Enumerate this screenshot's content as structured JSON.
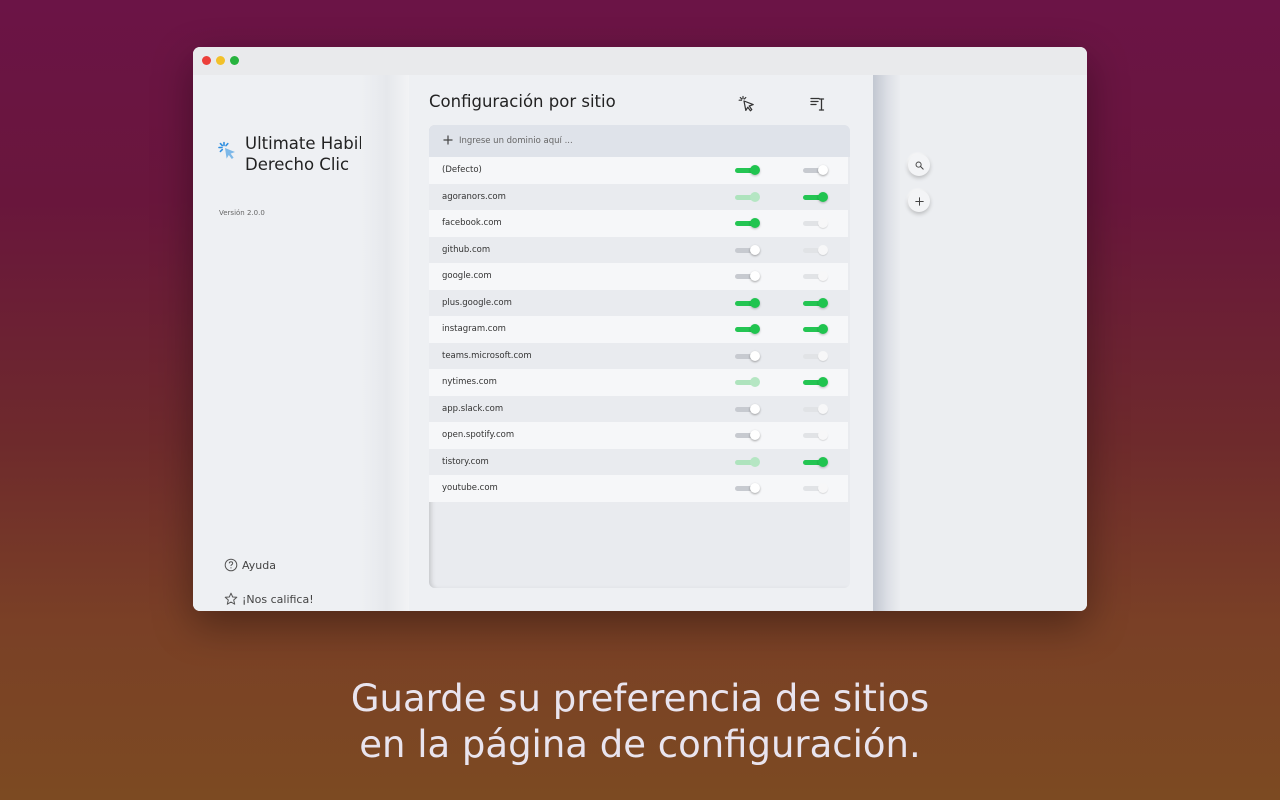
{
  "window": {
    "controls": {
      "red": "#ec3f3a",
      "yellow": "#f2c12a",
      "green": "#27b33e"
    }
  },
  "sidebar": {
    "app_title_line1": "Ultimate Habilitar",
    "app_title_line2": "Derecho Clic",
    "version": "Versión 2.0.0",
    "help_label": "Ayuda",
    "rate_label": "¡Nos califica!",
    "icons": {
      "logo": "cursor-sparkle-icon",
      "help": "question-circle-icon",
      "rate": "star-outline-icon"
    }
  },
  "main": {
    "title": "Configuración por sitio",
    "column_icons": [
      "cursor-click-icon",
      "text-select-icon"
    ],
    "add_placeholder": "Ingrese un dominio aquí ...",
    "accent_color": "#24c553",
    "rows": [
      {
        "domain": "(Defecto)",
        "right_click": "on",
        "text_select": "off"
      },
      {
        "domain": "agoranors.com",
        "right_click": "dim-on",
        "text_select": "on"
      },
      {
        "domain": "facebook.com",
        "right_click": "on",
        "text_select": "dim-off"
      },
      {
        "domain": "github.com",
        "right_click": "off",
        "text_select": "dim-off"
      },
      {
        "domain": "google.com",
        "right_click": "off",
        "text_select": "dim-off"
      },
      {
        "domain": "plus.google.com",
        "right_click": "on",
        "text_select": "on"
      },
      {
        "domain": "instagram.com",
        "right_click": "on",
        "text_select": "on"
      },
      {
        "domain": "teams.microsoft.com",
        "right_click": "off",
        "text_select": "dim-off"
      },
      {
        "domain": "nytimes.com",
        "right_click": "dim-on",
        "text_select": "on"
      },
      {
        "domain": "app.slack.com",
        "right_click": "off",
        "text_select": "dim-off"
      },
      {
        "domain": "open.spotify.com",
        "right_click": "off",
        "text_select": "dim-off"
      },
      {
        "domain": "tistory.com",
        "right_click": "dim-on",
        "text_select": "on"
      },
      {
        "domain": "youtube.com",
        "right_click": "off",
        "text_select": "dim-off"
      }
    ]
  },
  "right_panel": {
    "icons": [
      "search-icon",
      "plus-icon"
    ]
  },
  "caption": {
    "line1": "Guarde su preferencia de sitios",
    "line2": "en la página de configuración."
  }
}
